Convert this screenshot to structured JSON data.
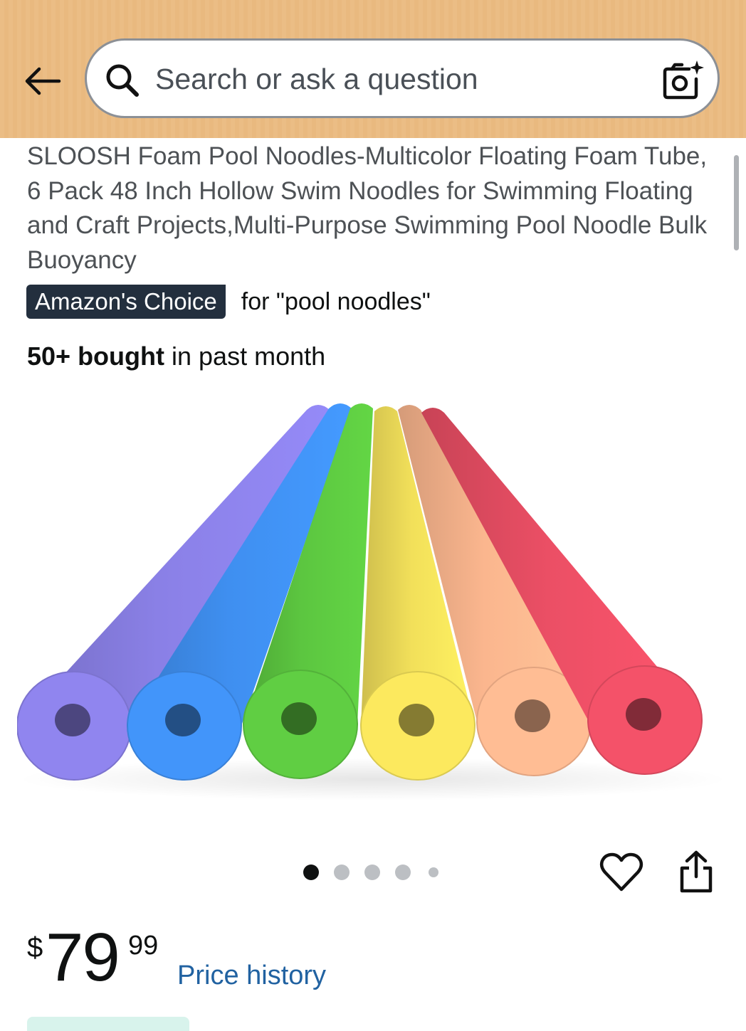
{
  "search": {
    "placeholder": "Search or ask a question",
    "back_icon": "arrow-left-icon",
    "search_icon": "magnifier-icon",
    "camera_icon": "camera-sparkle-icon",
    "header_color": "#ebbd85"
  },
  "product": {
    "title": "SLOOSH Foam Pool Noodles-Multicolor Floating Foam Tube, 6 Pack 48 Inch Hollow Swim Noodles for Swimming Floating and Craft Projects,Multi-Purpose Swimming Pool Noodle Bulk Buoyancy",
    "badge": "Amazon's Choice",
    "badge_for": "for \"pool noodles\"",
    "bought_bold": "50+ bought",
    "bought_rest": " in past month",
    "noodle_colors": [
      "#8a80e6",
      "#3f8ff0",
      "#5cc640",
      "#f2e05a",
      "#fbb68e",
      "#eb4f65"
    ],
    "image_count": 5,
    "active_image": 1
  },
  "actions": {
    "heart_icon": "heart-outline-icon",
    "share_icon": "share-icon"
  },
  "price": {
    "symbol": "$",
    "whole": "79",
    "fraction": "99",
    "history_link": "Price history"
  }
}
